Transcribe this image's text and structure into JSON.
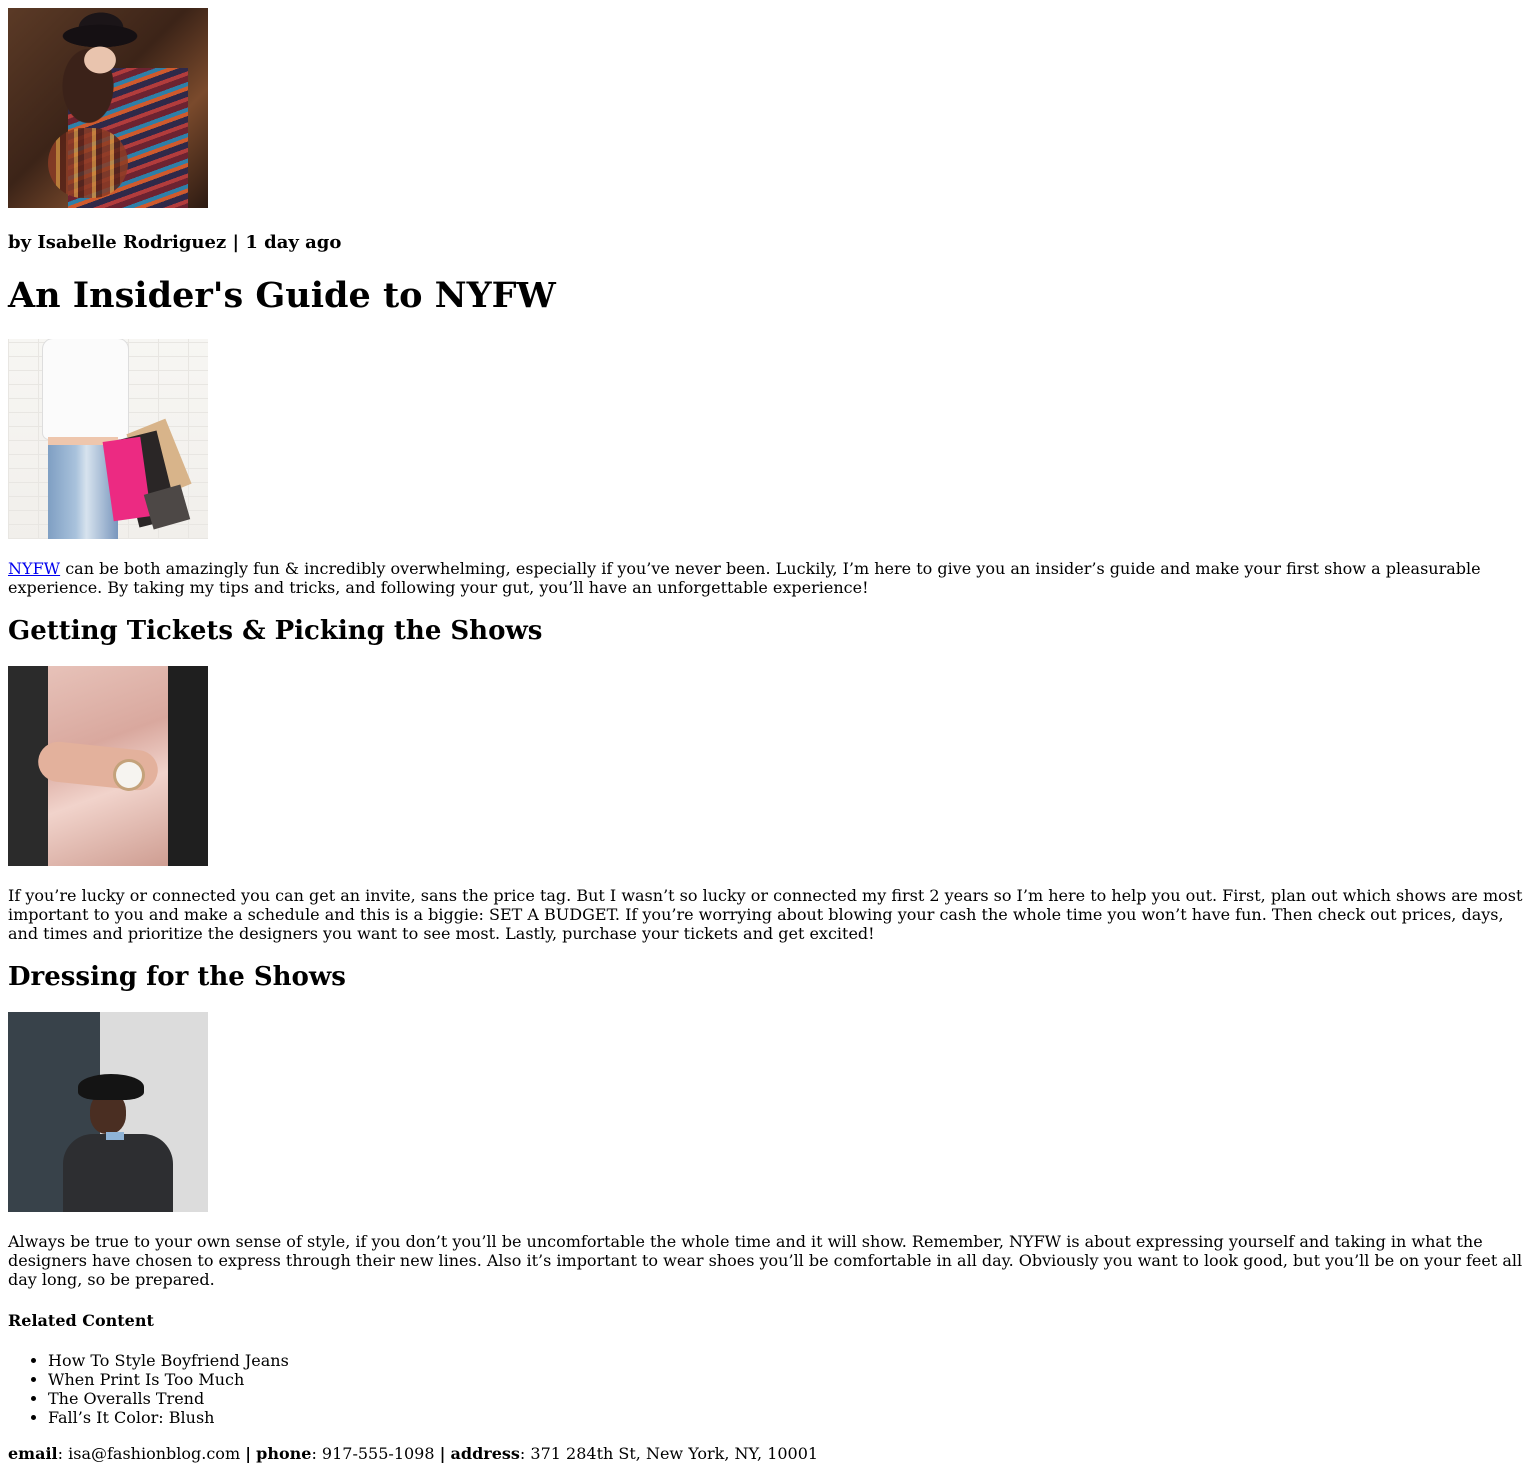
{
  "byline": {
    "prefix": "by",
    "author": "Isabelle Rodriguez",
    "separator": "|",
    "time": "1 day ago"
  },
  "article": {
    "title": "An Insider's Guide to NYFW",
    "intro": {
      "link_text": "NYFW",
      "text": " can be both amazingly fun & incredibly overwhelming, especially if you’ve never been. Luckily, I’m here to give you an insider’s guide and make your first show a pleasurable experience. By taking my tips and tricks, and following your gut, you’ll have an unforgettable experience!"
    },
    "sections": [
      {
        "heading": "Getting Tickets & Picking the Shows",
        "body": "If you’re lucky or connected you can get an invite, sans the price tag. But I wasn’t so lucky or connected my first 2 years so I’m here to help you out. First, plan out which shows are most important to you and make a schedule and this is a biggie: SET A BUDGET. If you’re worrying about blowing your cash the whole time you won’t have fun. Then check out prices, days, and times and prioritize the designers you want to see most. Lastly, purchase your tickets and get excited!"
      },
      {
        "heading": "Dressing for the Shows",
        "body": "Always be true to your own sense of style, if you don’t you’ll be uncomfortable the whole time and it will show. Remember, NYFW is about expressing yourself and taking in what the designers have chosen to express through their new lines. Also it’s important to wear shoes you’ll be comfortable in all day. Obviously you want to look good, but you’ll be on your feet all day long, so be prepared."
      }
    ]
  },
  "related": {
    "title": "Related Content",
    "items": [
      "How To Style Boyfriend Jeans",
      "When Print Is Too Much",
      "The Overalls Trend",
      "Fall’s It Color: Blush"
    ]
  },
  "contact": {
    "email_label": "email",
    "email": "isa@fashionblog.com",
    "phone_label": "phone",
    "phone": "917-555-1098",
    "address_label": "address",
    "address": "371 284th St, New York, NY, 10001",
    "separator": "|"
  },
  "colors": {
    "link": "#0000ee",
    "text": "#000000",
    "background": "#ffffff"
  },
  "images": [
    "woman-in-hat-photo",
    "shopping-bags-photo",
    "wristwatch-photo",
    "man-in-hat-street-photo"
  ]
}
